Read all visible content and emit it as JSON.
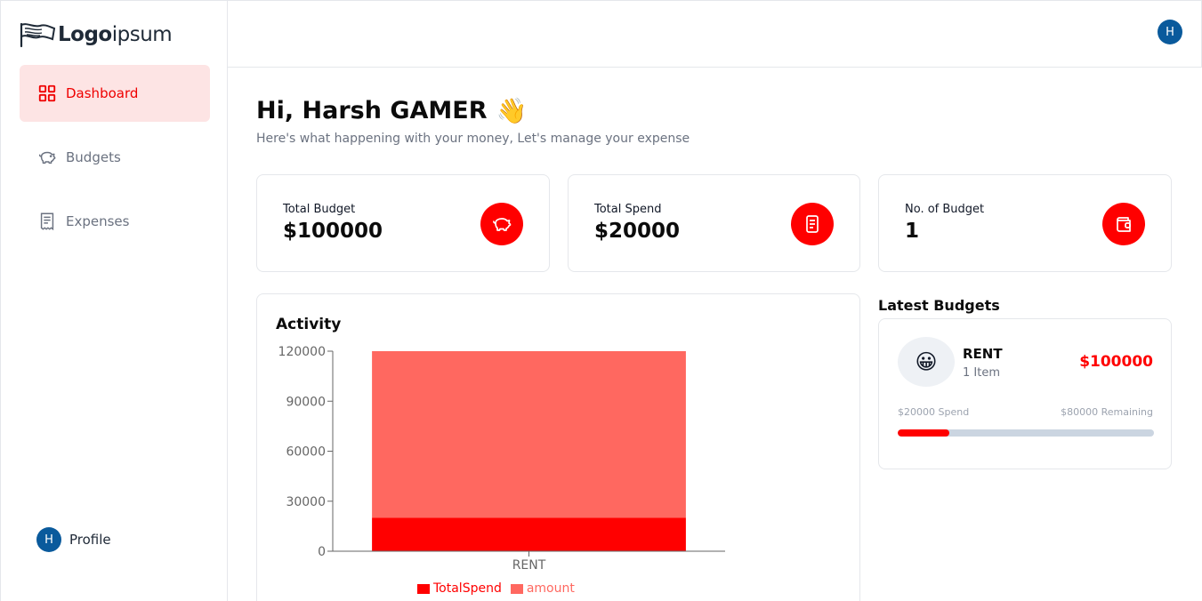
{
  "brand": {
    "logo_bold": "Logo",
    "logo_light": "ipsum"
  },
  "sidebar": {
    "items": [
      {
        "label": "Dashboard",
        "icon": "grid-icon",
        "active": true
      },
      {
        "label": "Budgets",
        "icon": "piggy-bank-icon",
        "active": false
      },
      {
        "label": "Expenses",
        "icon": "receipt-icon",
        "active": false
      }
    ],
    "profile": {
      "initial": "H",
      "label": "Profile"
    }
  },
  "header": {
    "avatar_initial": "H"
  },
  "greeting": {
    "title": "Hi, Harsh GAMER",
    "emoji": "👋",
    "subtitle": "Here's what happening with your money, Let's manage your expense"
  },
  "cards": [
    {
      "label": "Total Budget",
      "value": "$100000",
      "icon": "piggy-bank-icon"
    },
    {
      "label": "Total Spend",
      "value": "$20000",
      "icon": "receipt-icon"
    },
    {
      "label": "No. of Budget",
      "value": "1",
      "icon": "wallet-icon"
    }
  ],
  "activity": {
    "title": "Activity"
  },
  "chart_data": {
    "type": "bar",
    "stacked": true,
    "categories": [
      "RENT"
    ],
    "series": [
      {
        "name": "TotalSpend",
        "values": [
          20000
        ],
        "color": "#ff0000"
      },
      {
        "name": "amount",
        "values": [
          100000
        ],
        "color": "#ff6860"
      }
    ],
    "yticks": [
      "0",
      "30000",
      "60000",
      "90000",
      "120000"
    ],
    "ylim": [
      0,
      120000
    ],
    "legend_position": "bottom"
  },
  "latest": {
    "title": "Latest Budgets",
    "budget": {
      "emoji": "😀",
      "name": "RENT",
      "items": "1 Item",
      "amount": "$100000",
      "spend_text": "$20000 Spend",
      "remaining_text": "$80000 Remaining",
      "progress": 0.2
    }
  },
  "colors": {
    "accent": "#ff0000",
    "accent_light": "#fde4e4",
    "avatar": "#0a5a9c"
  }
}
